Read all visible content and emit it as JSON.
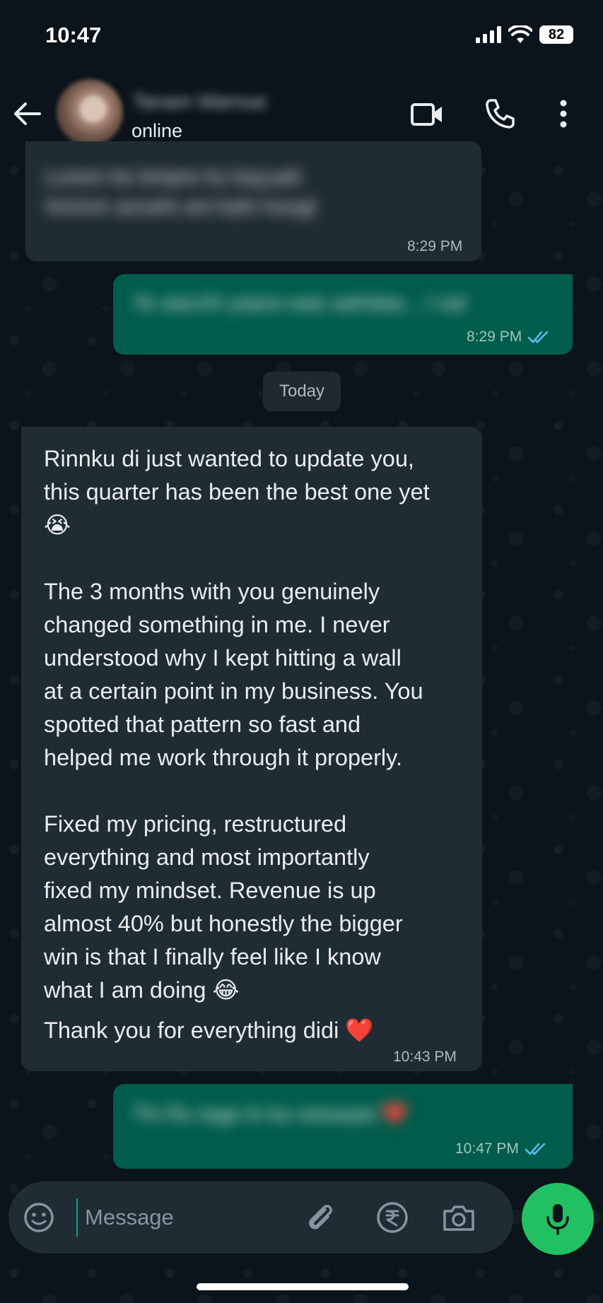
{
  "status_bar": {
    "time": "10:47",
    "battery": "82"
  },
  "header": {
    "contact_name": "Tanam Warnue",
    "presence": "online"
  },
  "messages": [
    {
      "direction": "incoming",
      "text": "Lorem ke bntare ko kayuah\nhmmm arowhi ani kahi hoogl",
      "time": "8:29 PM",
      "blurred": true
    },
    {
      "direction": "outgoing",
      "text": "Ye aacchi yaara wao aahdaa... I sat",
      "time": "8:29 PM",
      "blurred": true,
      "read": true
    },
    {
      "direction": "incoming",
      "time": "10:43 PM",
      "blurred": false,
      "paragraphs": [
        "Rinnku di just wanted to update you,\nthis quarter has been the best one yet\n😭",
        "The 3 months with you genuinely\nchanged something in me. I never\nunderstood why I kept hitting a wall\nat a certain point in my business. You\nspotted that pattern so fast and\nhelped me work through it properly.",
        "Fixed my pricing, restructured\neverything and most importantly\nfixed my mindset. Revenue is up\nalmost 40% but honestly the bigger\nwin is that I finally feel like I know\nwhat I am doing 😂",
        "Thank you for everything didi ❤️"
      ]
    },
    {
      "direction": "outgoing",
      "text": "Thi Ru tage ki ka wasaaat ❤️",
      "time": "10:47 PM",
      "blurred": true,
      "read": true
    }
  ],
  "date_divider": "Today",
  "composer": {
    "placeholder": "Message"
  },
  "colors": {
    "background": "#0b141a",
    "incoming_bubble": "#202c33",
    "outgoing_bubble": "#005c4b",
    "mic_button": "#21c063",
    "read_ticks": "#53bdeb"
  },
  "icons": [
    "back-arrow-icon",
    "video-call-icon",
    "phone-icon",
    "more-vert-icon",
    "emoji-icon",
    "paperclip-icon",
    "rupee-icon",
    "camera-icon",
    "mic-icon",
    "read-double-check-icon",
    "signal-icon",
    "wifi-icon"
  ]
}
